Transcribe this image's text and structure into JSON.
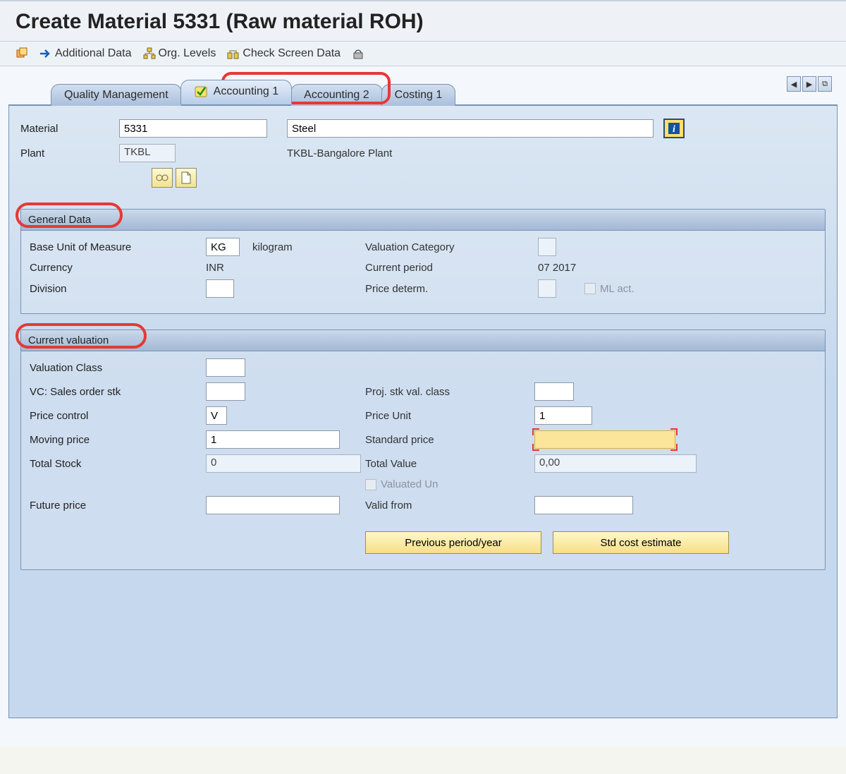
{
  "title": "Create Material 5331 (Raw material ROH)",
  "toolbar": {
    "additional_data": "Additional Data",
    "org_levels": "Org. Levels",
    "check_screen": "Check Screen Data"
  },
  "tabs": {
    "quality_mgmt": "Quality Management",
    "accounting1": "Accounting 1",
    "accounting2": "Accounting 2",
    "costing1": "Costing 1"
  },
  "header": {
    "material_label": "Material",
    "material_value": "5331",
    "material_desc": "Steel",
    "plant_label": "Plant",
    "plant_value": "TKBL",
    "plant_desc": "TKBL-Bangalore Plant"
  },
  "general": {
    "title": "General Data",
    "base_uom_label": "Base Unit of Measure",
    "base_uom_value": "KG",
    "base_uom_text": "kilogram",
    "valuation_cat_label": "Valuation Category",
    "currency_label": "Currency",
    "currency_value": "INR",
    "current_period_label": "Current period",
    "current_period_value": "07 2017",
    "division_label": "Division",
    "price_determ_label": "Price determ.",
    "ml_act_label": "ML act."
  },
  "valuation": {
    "title": "Current valuation",
    "valuation_class_label": "Valuation Class",
    "vc_sales_label": "VC: Sales order stk",
    "proj_stk_label": "Proj. stk val. class",
    "price_control_label": "Price control",
    "price_control_value": "V",
    "price_unit_label": "Price Unit",
    "price_unit_value": "1",
    "moving_price_label": "Moving price",
    "moving_price_value": "1",
    "standard_price_label": "Standard price",
    "total_stock_label": "Total Stock",
    "total_stock_value": "0",
    "total_value_label": "Total Value",
    "total_value_value": "0,00",
    "valuated_un_label": "Valuated Un",
    "future_price_label": "Future price",
    "valid_from_label": "Valid from",
    "previous_btn": "Previous period/year",
    "std_cost_btn": "Std cost estimate"
  }
}
